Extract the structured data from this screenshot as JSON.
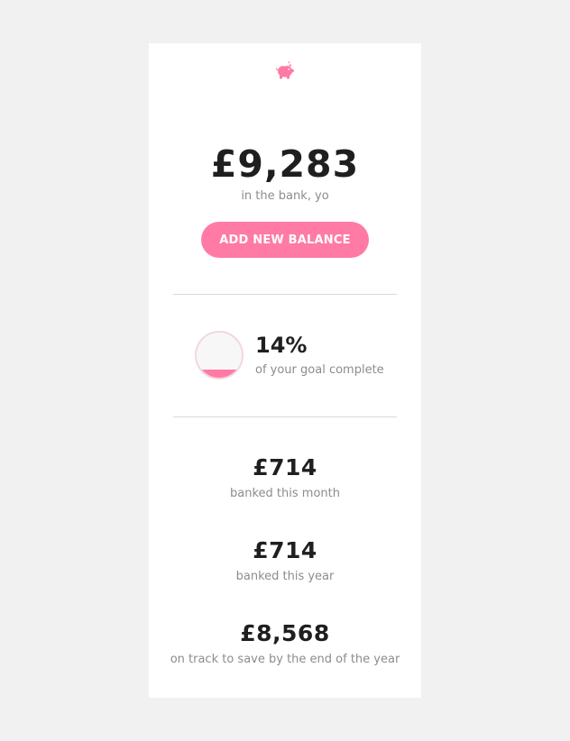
{
  "brand": {
    "logo_icon": "piggy-bank-icon",
    "accent_color": "#ff7aa4"
  },
  "balance": {
    "amount": "£9,283",
    "caption": "in the bank, yo",
    "add_button_label": "ADD NEW BALANCE"
  },
  "goal": {
    "percent_label": "14%",
    "percent_value": 0.14,
    "caption": "of your goal complete"
  },
  "stats": [
    {
      "amount": "£714",
      "caption": "banked this month"
    },
    {
      "amount": "£714",
      "caption": "banked this year"
    },
    {
      "amount": "£8,568",
      "caption": "on track to save by the end of the year"
    }
  ]
}
